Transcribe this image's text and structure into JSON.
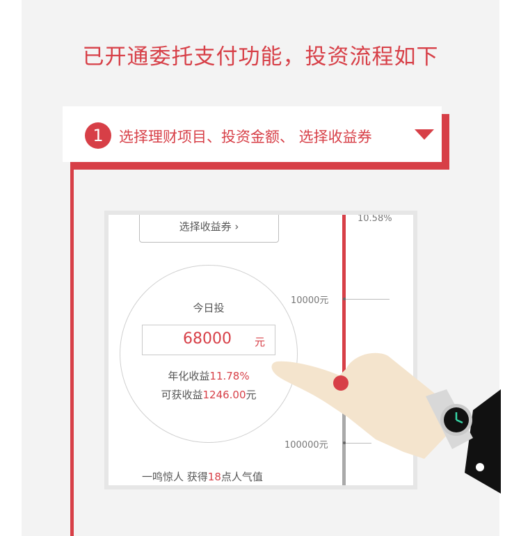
{
  "heading": "已开通委托支付功能，投资流程如下",
  "step": {
    "number": "1",
    "text": "选择理财项目、投资金额、 选择收益券"
  },
  "screen": {
    "coupon_button": "选择收益券 ›",
    "today_label": "今日投",
    "amount_value": "68000",
    "amount_unit": "元",
    "annual_label": "年化收益",
    "annual_value": "11.78%",
    "earn_label": "可获收益",
    "earn_value": "1246.00",
    "earn_unit": "元",
    "footer_prefix": "一鸣惊人 获得",
    "footer_number": "18",
    "footer_suffix": "点人气值",
    "slider_labels": {
      "top": "10.58%",
      "mid": "10000元",
      "bottom": "100000元"
    }
  },
  "colors": {
    "accent": "#d73f47",
    "panel_bg": "#f3f3f3",
    "phone_frame": "#e6e6e6"
  },
  "icons": [
    "dropdown-triangle-icon",
    "pointing-hand-icon",
    "wristwatch-icon"
  ]
}
